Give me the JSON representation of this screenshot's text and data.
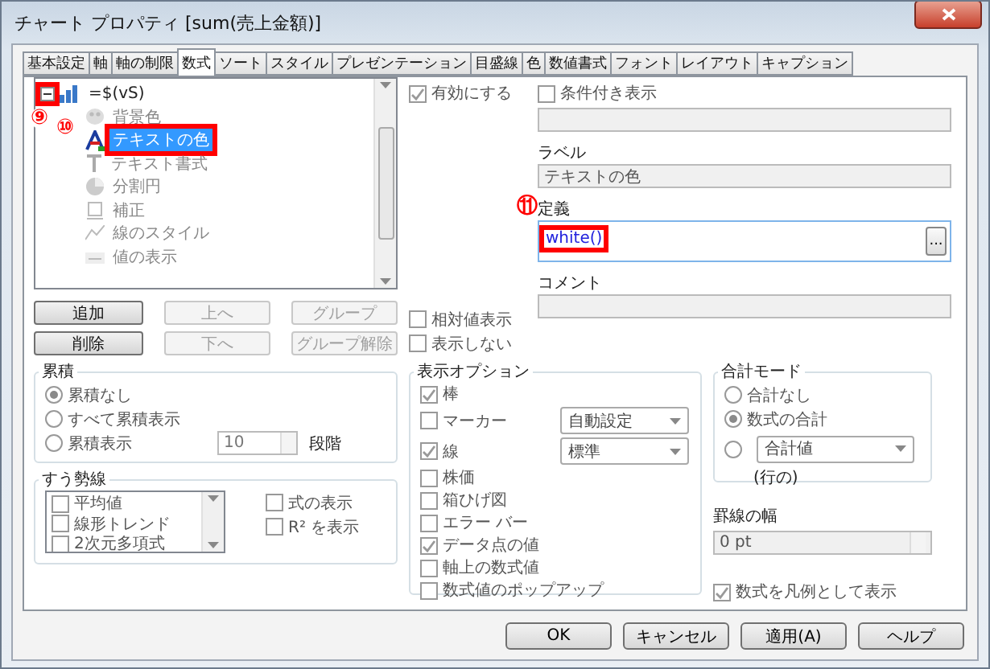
{
  "window": {
    "title": "チャート プロパティ [sum(売上金額)]"
  },
  "tabs": [
    {
      "label": "基本設定",
      "selected": false
    },
    {
      "label": "軸",
      "selected": false
    },
    {
      "label": "軸の制限",
      "selected": false
    },
    {
      "label": "数式",
      "selected": true
    },
    {
      "label": "ソート",
      "selected": false
    },
    {
      "label": "スタイル",
      "selected": false
    },
    {
      "label": "プレゼンテーション",
      "selected": false
    },
    {
      "label": "目盛線",
      "selected": false
    },
    {
      "label": "色",
      "selected": false
    },
    {
      "label": "数値書式",
      "selected": false
    },
    {
      "label": "フォント",
      "selected": false
    },
    {
      "label": "レイアウト",
      "selected": false
    },
    {
      "label": "キャプション",
      "selected": false
    }
  ],
  "tree": {
    "items": [
      {
        "label": "=$(vS)",
        "kind": "bar",
        "expanded": true,
        "selected": false,
        "highlighted": true,
        "annotation": "⑨",
        "children": [
          {
            "label": "背景色",
            "kind": "palette",
            "selected": false,
            "highlighted": false
          },
          {
            "label": "テキストの色",
            "kind": "text-color",
            "selected": true,
            "highlighted": true,
            "annotation": "⑩"
          },
          {
            "label": "テキスト書式",
            "kind": "text-format",
            "selected": false,
            "highlighted": false
          },
          {
            "label": "分割円",
            "kind": "pie",
            "selected": false,
            "highlighted": false
          },
          {
            "label": "補正",
            "kind": "shift",
            "selected": false,
            "highlighted": false
          },
          {
            "label": "線のスタイル",
            "kind": "line",
            "selected": false,
            "highlighted": false
          },
          {
            "label": "値の表示",
            "kind": "value",
            "selected": false,
            "highlighted": false
          }
        ]
      }
    ]
  },
  "tree_buttons": [
    {
      "label": "追加",
      "disabled": false
    },
    {
      "label": "上へ",
      "disabled": true
    },
    {
      "label": "グループ",
      "disabled": true
    },
    {
      "label": "削除",
      "disabled": false
    },
    {
      "label": "下へ",
      "disabled": true
    },
    {
      "label": "グループ解除",
      "disabled": true
    }
  ],
  "enable": {
    "label": "有効にする",
    "checked": true
  },
  "relative": [
    {
      "label": "相対値表示",
      "checked": false
    },
    {
      "label": "表示しない",
      "checked": false
    }
  ],
  "conditional": {
    "label": "条件付き表示",
    "checked": false
  },
  "label_field": {
    "label": "ラベル",
    "value": "テキストの色"
  },
  "definition": {
    "label": "定義",
    "value": "white()",
    "highlighted": true,
    "annotation": "⑪",
    "button": "..."
  },
  "comment": {
    "label": "コメント"
  },
  "accumulation": {
    "title": "累積",
    "options": [
      {
        "label": "累積なし",
        "selected": true
      },
      {
        "label": "すべて累積表示",
        "selected": false
      },
      {
        "label": "累積表示",
        "selected": false
      }
    ],
    "steps": "10",
    "steps_label": "段階"
  },
  "trend": {
    "title": "すう勢線",
    "items": [
      {
        "label": "平均値",
        "checked": false
      },
      {
        "label": "線形トレンド",
        "checked": false
      },
      {
        "label": "2次元多項式",
        "checked": false
      }
    ],
    "options": [
      {
        "label": "式の表示",
        "checked": false
      },
      {
        "label": "R² を表示",
        "checked": false
      }
    ]
  },
  "display_options": {
    "title": "表示オプション",
    "items": [
      {
        "label": "棒",
        "checked": true
      },
      {
        "label": "マーカー",
        "checked": false,
        "select": "自動設定"
      },
      {
        "label": "線",
        "checked": true,
        "select": "標準"
      },
      {
        "label": "株価",
        "checked": false
      },
      {
        "label": "箱ひげ図",
        "checked": false
      },
      {
        "label": "エラー バー",
        "checked": false
      },
      {
        "label": "データ点の値",
        "checked": true
      },
      {
        "label": "軸上の数式値",
        "checked": false
      },
      {
        "label": "数式値のポップアップ",
        "checked": false
      }
    ]
  },
  "total_mode": {
    "title": "合計モード",
    "options": [
      {
        "label": "合計なし",
        "selected": false
      },
      {
        "label": "数式の合計",
        "selected": true
      },
      {
        "selected": false
      }
    ],
    "select": "合計値",
    "suffix": "(行の)"
  },
  "border_width": {
    "label": "罫線の幅",
    "value": "0 pt"
  },
  "legend": {
    "label": "数式を凡例として表示",
    "checked": true
  },
  "buttons": [
    "OK",
    "キャンセル",
    "適用(A)",
    "ヘルプ"
  ]
}
